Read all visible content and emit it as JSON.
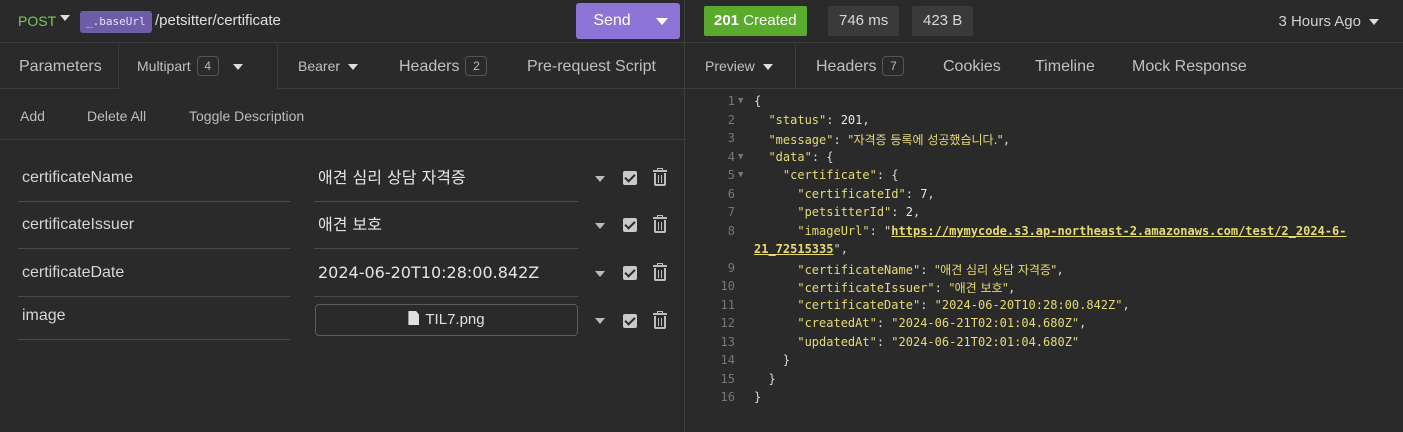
{
  "request": {
    "method": "POST",
    "env_tag": "_.baseUrl",
    "path": "/petsitter/certificate",
    "send_label": "Send"
  },
  "request_tabs": {
    "parameters": "Parameters",
    "multipart": "Multipart",
    "multipart_count": "4",
    "bearer": "Bearer",
    "headers": "Headers",
    "headers_count": "2",
    "prerequest": "Pre-request Script"
  },
  "actions": {
    "add": "Add",
    "delete_all": "Delete All",
    "toggle_description": "Toggle Description"
  },
  "fields": [
    {
      "name": "certificateName",
      "value": "애견 심리 상담 자격증"
    },
    {
      "name": "certificateIssuer",
      "value": "애견 보호"
    },
    {
      "name": "certificateDate",
      "value": "2024-06-20T10:28:00.842Z"
    },
    {
      "name": "image",
      "value": "TIL7.png"
    }
  ],
  "response": {
    "status_code": "201",
    "status_text": "Created",
    "time": "746 ms",
    "size": "423 B",
    "ago": "3 Hours Ago"
  },
  "response_tabs": {
    "preview": "Preview",
    "headers": "Headers",
    "headers_count": "7",
    "cookies": "Cookies",
    "timeline": "Timeline",
    "mock": "Mock Response"
  },
  "code_lines": [
    {
      "num": "1",
      "fold": true
    },
    {
      "num": "2"
    },
    {
      "num": "3"
    },
    {
      "num": "4",
      "fold": true
    },
    {
      "num": "5",
      "fold": true
    },
    {
      "num": "6"
    },
    {
      "num": "7"
    },
    {
      "num": "8"
    },
    {
      "num": ""
    },
    {
      "num": "9"
    },
    {
      "num": "10"
    },
    {
      "num": "11"
    },
    {
      "num": "12"
    },
    {
      "num": "13"
    },
    {
      "num": "14"
    },
    {
      "num": "15"
    },
    {
      "num": "16"
    }
  ],
  "json": {
    "k_status": "\"status\"",
    "v_status": "201",
    "k_message": "\"message\"",
    "v_message": "\"자격증 등록에 성공했습니다.\"",
    "k_data": "\"data\"",
    "k_certificate": "\"certificate\"",
    "k_certificateId": "\"certificateId\"",
    "v_certificateId": "7",
    "k_petsitterId": "\"petsitterId\"",
    "v_petsitterId": "2",
    "k_imageUrl": "\"imageUrl\"",
    "v_imageUrl_1": "https://mymycode.s3.ap-northeast-2.amazonaws.com/test/2_2024-6-",
    "v_imageUrl_2": "21_72515335",
    "k_certificateName": "\"certificateName\"",
    "v_certificateName": "\"애견 심리 상담 자격증\"",
    "k_certificateIssuer": "\"certificateIssuer\"",
    "v_certificateIssuer": "\"애견 보호\"",
    "k_certificateDate": "\"certificateDate\"",
    "v_certificateDate": "\"2024-06-20T10:28:00.842Z\"",
    "k_createdAt": "\"createdAt\"",
    "v_createdAt": "\"2024-06-21T02:01:04.680Z\"",
    "k_updatedAt": "\"updatedAt\"",
    "v_updatedAt": "\"2024-06-21T02:01:04.680Z\""
  }
}
